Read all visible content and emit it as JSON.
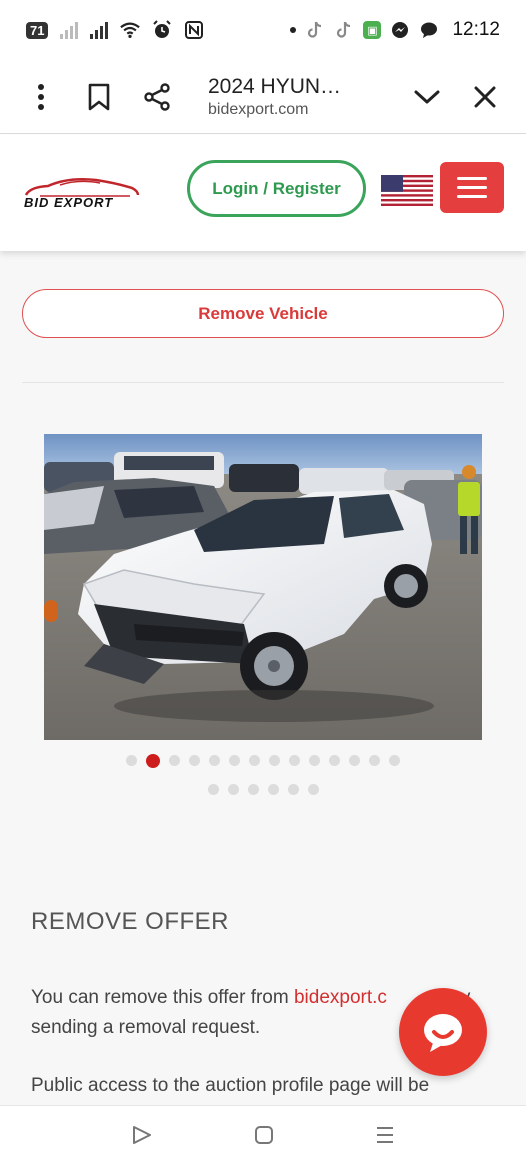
{
  "status_bar": {
    "battery_badge": "71",
    "time": "12:12",
    "icons": [
      "battery-saver-icon",
      "signal-icon",
      "signal-icon",
      "wifi-icon",
      "alarm-icon",
      "nfc-icon",
      "dot-icon",
      "tiktok-icon",
      "tiktok-icon",
      "app-icon",
      "messenger-icon",
      "chat-icon"
    ]
  },
  "tab_bar": {
    "title": "2024 HYUN…",
    "url": "bidexport.com"
  },
  "header": {
    "logo_text": "BID EXPORT",
    "login_label": "Login / Register",
    "brand_color": "#e53e3e",
    "login_color": "#3aa45a"
  },
  "content": {
    "remove_vehicle_label": "Remove Vehicle",
    "carousel": {
      "total_images": 20,
      "active_index": 1
    },
    "offer_title": "REMOVE OFFER",
    "para1_pre": "You can remove this offer from ",
    "para1_link": "bidexport.c",
    "para1_post": "y",
    "para1_line2": "sending a removal request.",
    "para2": "Public access to the auction profile page will be"
  },
  "nav_bar": {
    "icons": [
      "back-icon",
      "home-icon",
      "recents-icon"
    ]
  }
}
